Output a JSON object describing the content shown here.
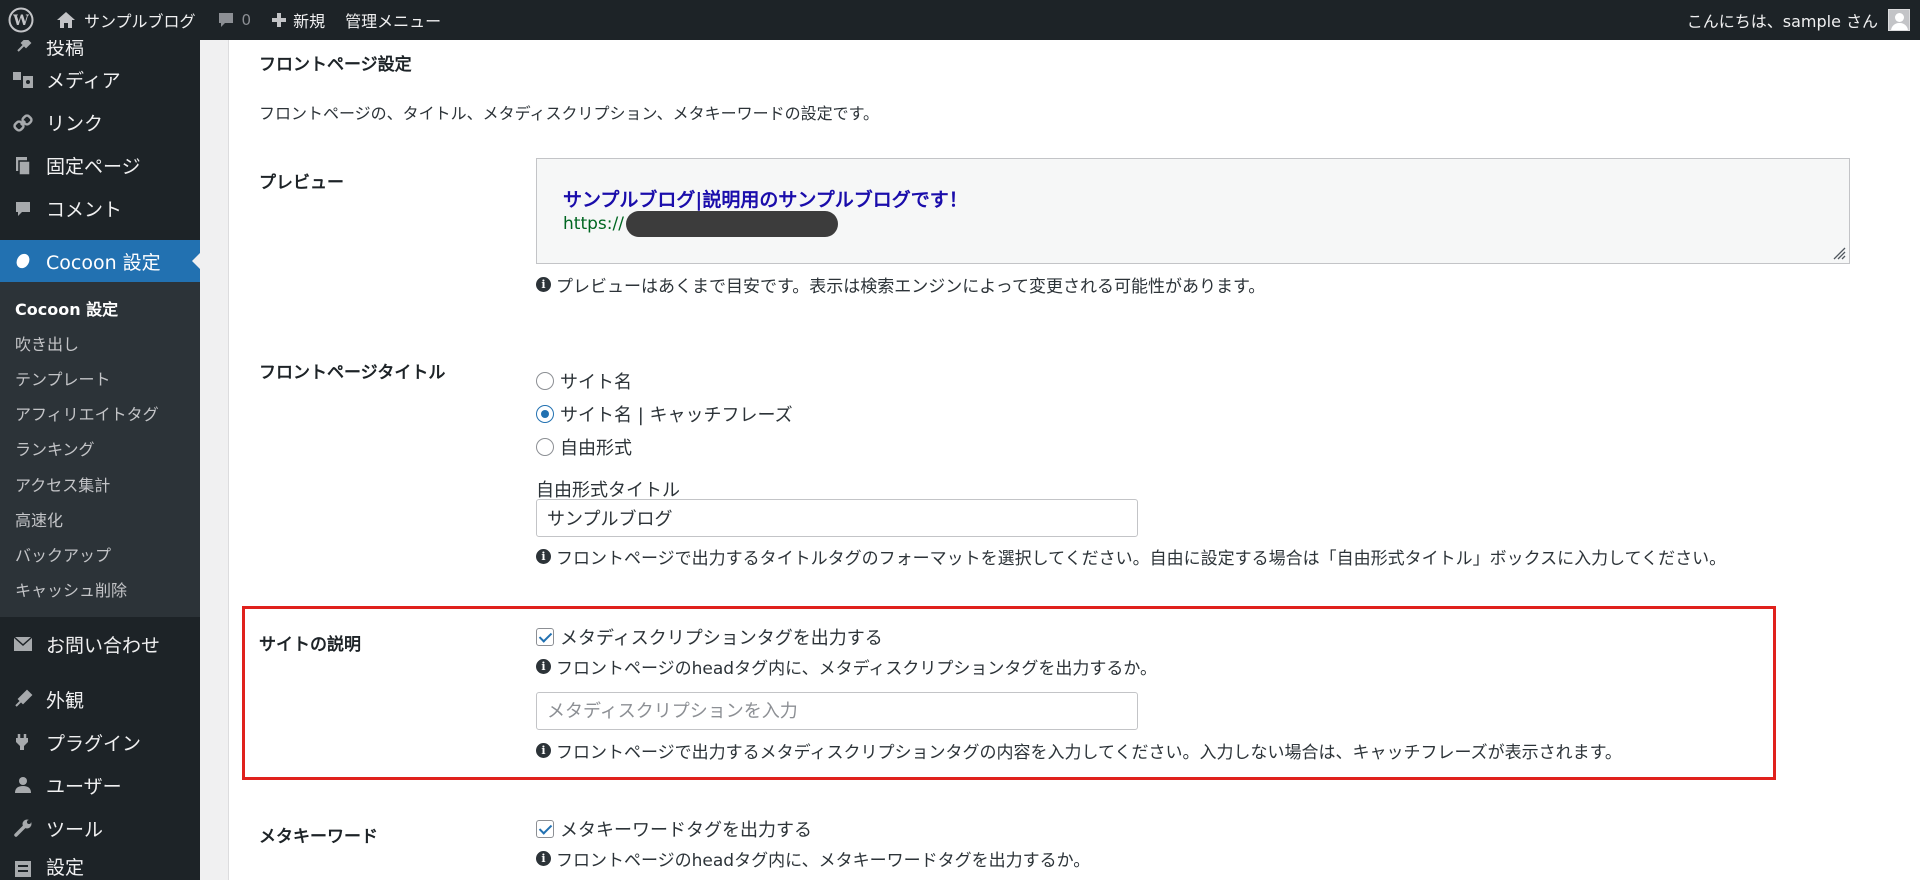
{
  "adminbar": {
    "site_name": "サンプルブログ",
    "comments_count": "0",
    "new_label": "新規",
    "admin_menu_label": "管理メニュー",
    "greeting": "こんにちは、sample さん"
  },
  "sidebar": {
    "items_top": [
      {
        "label": "投稿",
        "icon": "pin-icon"
      },
      {
        "label": "メディア",
        "icon": "media-icon"
      },
      {
        "label": "リンク",
        "icon": "link-icon"
      },
      {
        "label": "固定ページ",
        "icon": "page-icon"
      },
      {
        "label": "コメント",
        "icon": "comment-icon"
      }
    ],
    "active_item": {
      "label": "Cocoon 設定",
      "icon": "cocoon-icon"
    },
    "submenu": [
      "Cocoon 設定",
      "吹き出し",
      "テンプレート",
      "アフィリエイトタグ",
      "ランキング",
      "アクセス集計",
      "高速化",
      "バックアップ",
      "キャッシュ削除"
    ],
    "items_bottom": [
      {
        "label": "お問い合わせ",
        "icon": "mail-icon"
      },
      {
        "label": "外観",
        "icon": "brush-icon"
      },
      {
        "label": "プラグイン",
        "icon": "plugin-icon"
      },
      {
        "label": "ユーザー",
        "icon": "user-icon"
      },
      {
        "label": "ツール",
        "icon": "wrench-icon"
      },
      {
        "label": "設定",
        "icon": "settings-icon"
      }
    ]
  },
  "main": {
    "section_title": "フロントページ設定",
    "section_desc": "フロントページの、タイトル、メタディスクリプション、メタキーワードの設定です。",
    "preview": {
      "label": "プレビュー",
      "title": "サンプルブログ|説明用のサンプルブログです！",
      "url_prefix": "https://",
      "note": "プレビューはあくまで目安です。表示は検索エンジンによって変更される可能性があります。"
    },
    "front_title": {
      "label": "フロントページタイトル",
      "options": [
        "サイト名",
        "サイト名 | キャッチフレーズ",
        "自由形式"
      ],
      "selected_index": 1,
      "free_title_label": "自由形式タイトル",
      "free_title_value": "サンプルブログ",
      "note": "フロントページで出力するタイトルタグのフォーマットを選択してください。自由に設定する場合は「自由形式タイトル」ボックスに入力してください。"
    },
    "site_desc": {
      "label": "サイトの説明",
      "checkbox_label": "メタディスクリプションタグを出力する",
      "checked": true,
      "note1": "フロントページのheadタグ内に、メタディスクリプションタグを出力するか。",
      "input_placeholder": "メタディスクリプションを入力",
      "note2": "フロントページで出力するメタディスクリプションタグの内容を入力してください。入力しない場合は、キャッチフレーズが表示されます。"
    },
    "meta_keywords": {
      "label": "メタキーワード",
      "checkbox_label": "メタキーワードタグを出力する",
      "checked": true,
      "note": "フロントページのheadタグ内に、メタキーワードタグを出力するか。"
    }
  },
  "colors": {
    "highlight": "#e0211d",
    "accent": "#2271b1",
    "preview_title": "#1a0dab",
    "preview_url": "#006621"
  }
}
